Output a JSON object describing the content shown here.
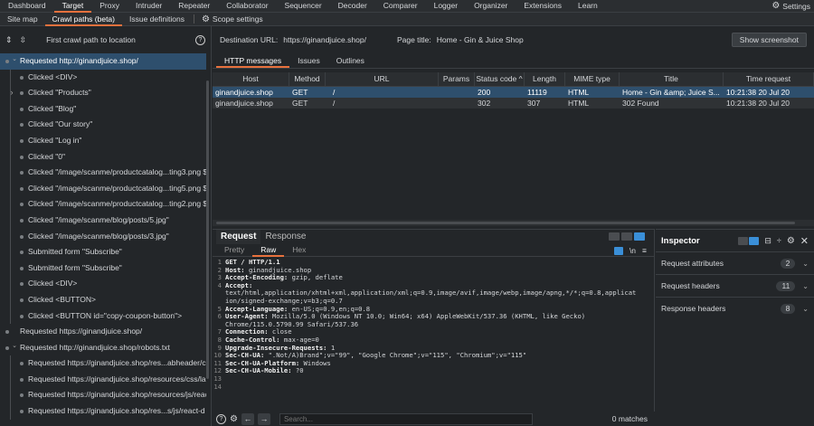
{
  "menubar": {
    "items": [
      "Dashboard",
      "Target",
      "Proxy",
      "Intruder",
      "Repeater",
      "Collaborator",
      "Sequencer",
      "Decoder",
      "Comparer",
      "Logger",
      "Organizer",
      "Extensions",
      "Learn"
    ],
    "active_index": 1,
    "settings_label": "Settings"
  },
  "subtabs": {
    "items": [
      "Site map",
      "Crawl paths (beta)",
      "Issue definitions"
    ],
    "active_index": 1,
    "scope_label": "Scope settings"
  },
  "crawl": {
    "header_title": "First crawl path to location",
    "nodes": [
      {
        "label": "Requested http://ginandjuice.shop/",
        "depth": 0,
        "chevron": "down",
        "selected": true
      },
      {
        "label": "Clicked <DIV>",
        "depth": 1,
        "chevron": "",
        "selected": false
      },
      {
        "label": "Clicked \"Products\"",
        "depth": 1,
        "chevron": "right",
        "selected": false
      },
      {
        "label": "Clicked \"Blog\"",
        "depth": 1,
        "chevron": "",
        "selected": false
      },
      {
        "label": "Clicked \"Our story\"",
        "depth": 1,
        "chevron": "",
        "selected": false
      },
      {
        "label": "Clicked \"Log in\"",
        "depth": 1,
        "chevron": "",
        "selected": false
      },
      {
        "label": "Clicked \"0\"",
        "depth": 1,
        "chevron": "",
        "selected": false
      },
      {
        "label": "Clicked \"/image/scanme/productcatalog...ting3.png $",
        "depth": 1,
        "chevron": "",
        "selected": false
      },
      {
        "label": "Clicked \"/image/scanme/productcatalog...ting5.png $",
        "depth": 1,
        "chevron": "",
        "selected": false
      },
      {
        "label": "Clicked \"/image/scanme/productcatalog...ting2.png $",
        "depth": 1,
        "chevron": "",
        "selected": false
      },
      {
        "label": "Clicked \"/image/scanme/blog/posts/5.jpg\"",
        "depth": 1,
        "chevron": "",
        "selected": false
      },
      {
        "label": "Clicked \"/image/scanme/blog/posts/3.jpg\"",
        "depth": 1,
        "chevron": "",
        "selected": false
      },
      {
        "label": "Submitted form \"Subscribe\"",
        "depth": 1,
        "chevron": "",
        "selected": false
      },
      {
        "label": "Submitted form \"Subscribe\"",
        "depth": 1,
        "chevron": "",
        "selected": false
      },
      {
        "label": "Clicked <DIV>",
        "depth": 1,
        "chevron": "",
        "selected": false
      },
      {
        "label": "Clicked <BUTTON>",
        "depth": 1,
        "chevron": "",
        "selected": false
      },
      {
        "label": "Clicked <BUTTON id=\"copy-coupon-button\">",
        "depth": 1,
        "chevron": "",
        "selected": false
      },
      {
        "label": "Requested https://ginandjuice.shop/",
        "depth": 0,
        "chevron": "",
        "selected": false
      },
      {
        "label": "Requested http://ginandjuice.shop/robots.txt",
        "depth": 0,
        "chevron": "down",
        "selected": false
      },
      {
        "label": "Requested https://ginandjuice.shop/res...abheader/c",
        "depth": 1,
        "chevron": "",
        "selected": false
      },
      {
        "label": "Requested https://ginandjuice.shop/resources/css/la",
        "depth": 1,
        "chevron": "",
        "selected": false
      },
      {
        "label": "Requested https://ginandjuice.shop/resources/js/reac",
        "depth": 1,
        "chevron": "",
        "selected": false
      },
      {
        "label": "Requested https://ginandjuice.shop/res...s/js/react-d",
        "depth": 1,
        "chevron": "",
        "selected": false
      }
    ]
  },
  "urlbar": {
    "dest_label": "Destination URL:",
    "dest_value": "https://ginandjuice.shop/",
    "title_label": "Page title:",
    "title_value": "Home - Gin & Juice Shop",
    "show_button": "Show screenshot"
  },
  "http_tabs": {
    "items": [
      "HTTP messages",
      "Issues",
      "Outlines"
    ],
    "active_index": 0
  },
  "table": {
    "columns": [
      "Host",
      "Method",
      "URL",
      "Params",
      "Status code ^",
      "Length",
      "MIME type",
      "Title",
      "Time request"
    ],
    "rows": [
      {
        "host": "ginandjuice.shop",
        "method": "GET",
        "url": "/",
        "params": "",
        "status": "200",
        "length": "11119",
        "mime": "HTML",
        "title": "Home - Gin &amp; Juice S...",
        "time": "10:21:38 20 Jul 20"
      },
      {
        "host": "ginandjuice.shop",
        "method": "GET",
        "url": "/",
        "params": "",
        "status": "302",
        "length": "307",
        "mime": "HTML",
        "title": "302 Found",
        "time": "10:21:38 20 Jul 20"
      }
    ]
  },
  "reqresp": {
    "tabs": [
      "Request",
      "Response"
    ],
    "active_index": 0,
    "view_tabs": [
      "Pretty",
      "Raw",
      "Hex"
    ],
    "view_active_index": 1,
    "newline_label": "\\n",
    "lines": [
      {
        "n": "1",
        "k": "GET / HTTP/1.1",
        "v": ""
      },
      {
        "n": "2",
        "k": "Host:",
        "v": " ginandjuice.shop"
      },
      {
        "n": "3",
        "k": "Accept-Encoding:",
        "v": " gzip, deflate"
      },
      {
        "n": "4",
        "k": "Accept:",
        "v": ""
      },
      {
        "n": "",
        "k": "",
        "v": "text/html,application/xhtml+xml,application/xml;q=0.9,image/avif,image/webp,image/apng,*/*;q=0.8,applicat"
      },
      {
        "n": "",
        "k": "",
        "v": "ion/signed-exchange;v=b3;q=0.7"
      },
      {
        "n": "5",
        "k": "Accept-Language:",
        "v": " en-US;q=0.9,en;q=0.8"
      },
      {
        "n": "6",
        "k": "User-Agent:",
        "v": " Mozilla/5.0 (Windows NT 10.0; Win64; x64) AppleWebKit/537.36 (KHTML, like Gecko)"
      },
      {
        "n": "",
        "k": "",
        "v": "Chrome/115.0.5790.99 Safari/537.36"
      },
      {
        "n": "7",
        "k": "Connection:",
        "v": " close"
      },
      {
        "n": "8",
        "k": "Cache-Control:",
        "v": " max-age=0"
      },
      {
        "n": "9",
        "k": "Upgrade-Insecure-Requests:",
        "v": " 1"
      },
      {
        "n": "10",
        "k": "Sec-CH-UA:",
        "v": " \".Not/A)Brand\";v=\"99\", \"Google Chrome\";v=\"115\", \"Chromium\";v=\"115\""
      },
      {
        "n": "11",
        "k": "Sec-CH-UA-Platform:",
        "v": " Windows"
      },
      {
        "n": "12",
        "k": "Sec-CH-UA-Mobile:",
        "v": " ?0"
      },
      {
        "n": "13",
        "k": "",
        "v": ""
      },
      {
        "n": "14",
        "k": "",
        "v": ""
      }
    ],
    "search_placeholder": "Search...",
    "matches": "0 matches"
  },
  "inspector": {
    "title": "Inspector",
    "rows": [
      {
        "label": "Request attributes",
        "count": "2"
      },
      {
        "label": "Request headers",
        "count": "11"
      },
      {
        "label": "Response headers",
        "count": "8"
      }
    ]
  },
  "colors": {
    "accent": "#e8713d",
    "selection": "#2e4f6d",
    "toggle_on": "#3a8fd8"
  }
}
